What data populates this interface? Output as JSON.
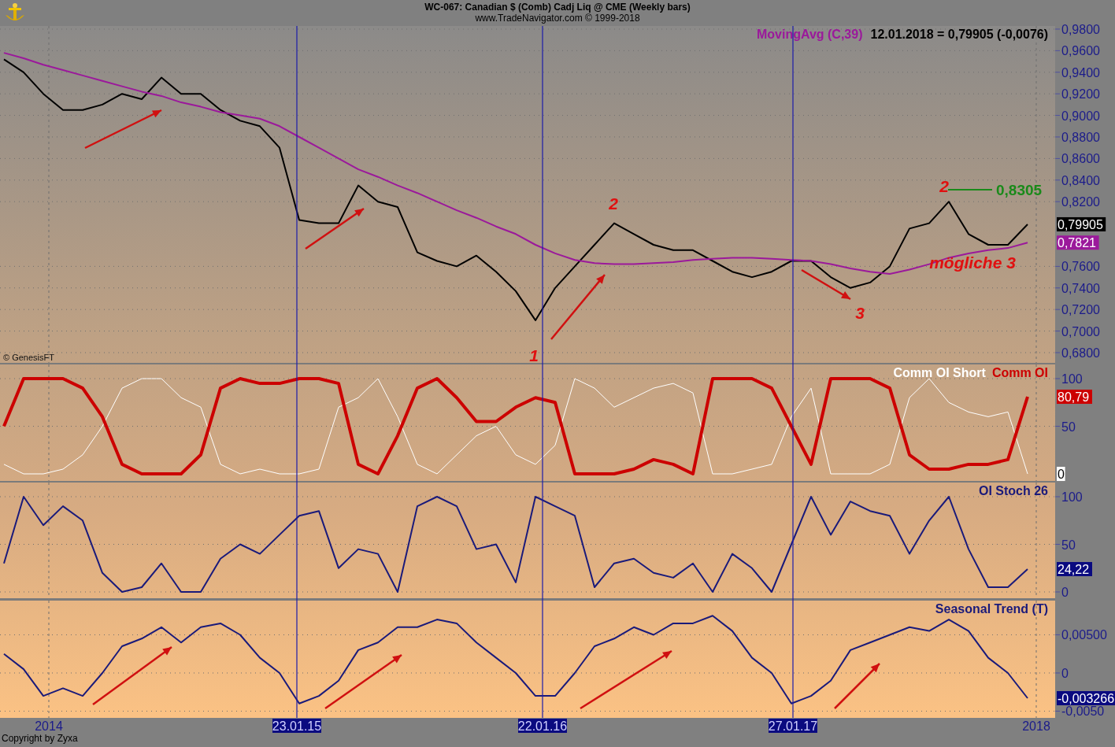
{
  "header": {
    "title": "WC-067:  Canadian $ (Comb) Cadj Liq @ CME  (Weekly bars)",
    "subtitle": "www.TradeNavigator.com © 1999-2018"
  },
  "source_note": "© GenesisFT",
  "time_axis": [
    {
      "label": "2014",
      "marked": false
    },
    {
      "label": "23.01.15",
      "marked": true
    },
    {
      "label": "22.01.16",
      "marked": true
    },
    {
      "label": "27.01.17",
      "marked": true
    },
    {
      "label": "2018",
      "marked": false
    }
  ],
  "panes": [
    {
      "kind": "price",
      "legend_value": "12.01.2018 = 0,79905 (-0,0076)",
      "labels": [
        {
          "kind": "wave",
          "text": "1"
        },
        {
          "kind": "wave",
          "text": "2"
        },
        {
          "kind": "wave",
          "text": "3"
        },
        {
          "kind": "wave",
          "text": "2"
        },
        {
          "kind": "wave",
          "text": "mögliche 3"
        },
        {
          "kind": "level",
          "text": "0,8305"
        }
      ],
      "value_flags": [
        {
          "text": "0,79905",
          "color": "#000000"
        },
        {
          "text": "0,7821",
          "color": "#9b199b"
        }
      ],
      "chart_data": {
        "type": "line",
        "grid": true,
        "ylim": [
          0.6705,
          0.9829
        ],
        "yticks": [
          {
            "value": 0.98,
            "label": "0,9800"
          },
          {
            "value": 0.96,
            "label": "0,9600"
          },
          {
            "value": 0.94,
            "label": "0,9400"
          },
          {
            "value": 0.92,
            "label": "0,9200"
          },
          {
            "value": 0.9,
            "label": "0,9000"
          },
          {
            "value": 0.88,
            "label": "0,8800"
          },
          {
            "value": 0.86,
            "label": "0,8600"
          },
          {
            "value": 0.84,
            "label": "0,8400"
          },
          {
            "value": 0.82,
            "label": "0,8200"
          },
          {
            "value": 0.76,
            "label": "0,7600"
          },
          {
            "value": 0.74,
            "label": "0,7400"
          },
          {
            "value": 0.72,
            "label": "0,7200"
          },
          {
            "value": 0.7,
            "label": "0,7000"
          },
          {
            "value": 0.68,
            "label": "0,6800"
          }
        ],
        "series": [
          {
            "color": "#000000",
            "values": [
              0.952,
              0.94,
              0.92,
              0.905,
              0.905,
              0.91,
              0.92,
              0.915,
              0.935,
              0.92,
              0.92,
              0.905,
              0.895,
              0.89,
              0.87,
              0.803,
              0.8,
              0.8,
              0.835,
              0.82,
              0.815,
              0.773,
              0.765,
              0.76,
              0.77,
              0.755,
              0.737,
              0.71,
              0.74,
              0.76,
              0.78,
              0.8,
              0.79,
              0.78,
              0.775,
              0.775,
              0.765,
              0.755,
              0.75,
              0.755,
              0.765,
              0.765,
              0.75,
              0.74,
              0.745,
              0.76,
              0.795,
              0.8,
              0.82,
              0.79,
              0.78,
              0.78,
              0.799
            ]
          },
          {
            "name": "MovingAvg (C,39)",
            "color": "#9b199b",
            "values": [
              0.958,
              0.953,
              0.947,
              0.942,
              0.937,
              0.932,
              0.927,
              0.922,
              0.918,
              0.912,
              0.908,
              0.903,
              0.9,
              0.897,
              0.89,
              0.88,
              0.87,
              0.86,
              0.85,
              0.843,
              0.835,
              0.828,
              0.82,
              0.812,
              0.805,
              0.797,
              0.79,
              0.78,
              0.772,
              0.766,
              0.763,
              0.762,
              0.762,
              0.763,
              0.764,
              0.766,
              0.767,
              0.768,
              0.768,
              0.767,
              0.766,
              0.765,
              0.762,
              0.758,
              0.755,
              0.753,
              0.757,
              0.762,
              0.768,
              0.772,
              0.775,
              0.777,
              0.782
            ]
          }
        ]
      }
    },
    {
      "kind": "comm",
      "value_flags": [
        {
          "text": "80,79",
          "color": "#cc0000"
        },
        {
          "text": "0",
          "color": "#ffffff"
        }
      ],
      "chart_data": {
        "type": "line",
        "grid": true,
        "ylim": [
          -7.4,
          114.9
        ],
        "yticks": [
          {
            "value": 50,
            "label": "50"
          },
          {
            "value": 100,
            "label": "100"
          }
        ],
        "series": [
          {
            "name": "Comm OI Short",
            "color": "#ffffff",
            "values": [
              10,
              0,
              0,
              5,
              20,
              50,
              90,
              100,
              100,
              80,
              70,
              10,
              0,
              5,
              0,
              0,
              5,
              70,
              80,
              100,
              60,
              10,
              0,
              20,
              40,
              50,
              20,
              10,
              30,
              100,
              90,
              70,
              80,
              90,
              95,
              85,
              0,
              0,
              5,
              10,
              60,
              90,
              0,
              0,
              0,
              10,
              80,
              100,
              75,
              65,
              60,
              65,
              0
            ]
          },
          {
            "name": "Comm OI",
            "color": "#cc0000",
            "values": [
              50,
              100,
              100,
              100,
              90,
              60,
              10,
              0,
              0,
              0,
              20,
              90,
              100,
              95,
              95,
              100,
              100,
              95,
              10,
              0,
              40,
              90,
              100,
              80,
              55,
              55,
              70,
              80,
              75,
              0,
              0,
              0,
              5,
              15,
              10,
              0,
              100,
              100,
              100,
              90,
              50,
              10,
              100,
              100,
              100,
              90,
              20,
              5,
              5,
              10,
              10,
              15,
              81
            ]
          }
        ]
      }
    },
    {
      "kind": "stoch",
      "value_flags": [
        {
          "text": "24,22",
          "color": "#0a0a80"
        }
      ],
      "chart_data": {
        "type": "line",
        "grid": true,
        "ylim": [
          -6.6,
          114.9
        ],
        "yticks": [
          {
            "value": 0,
            "label": "0"
          },
          {
            "value": 50,
            "label": "50"
          },
          {
            "value": 100,
            "label": "100"
          }
        ],
        "series": [
          {
            "name": "OI Stoch 26",
            "color": "#1a1a7a",
            "values": [
              30,
              100,
              70,
              90,
              75,
              20,
              0,
              5,
              30,
              0,
              0,
              35,
              50,
              40,
              60,
              80,
              85,
              25,
              45,
              40,
              0,
              90,
              100,
              90,
              45,
              50,
              10,
              100,
              90,
              80,
              5,
              30,
              35,
              20,
              15,
              30,
              0,
              40,
              25,
              0,
              50,
              100,
              60,
              95,
              85,
              80,
              40,
              75,
              100,
              45,
              5,
              5,
              24
            ]
          }
        ]
      }
    },
    {
      "kind": "seasonal",
      "value_flags": [
        {
          "text": "-0,003266",
          "color": "#0a0a80"
        }
      ],
      "chart_data": {
        "type": "line",
        "grid": true,
        "ylim": [
          -0.00588,
          0.00948
        ],
        "yticks": [
          {
            "value": -0.005,
            "label": "-0,0050"
          },
          {
            "value": 0,
            "label": "0"
          },
          {
            "value": 0.005,
            "label": "0,00500"
          }
        ],
        "series": [
          {
            "name": "Seasonal Trend (T)",
            "color": "#1a1a7a",
            "values": [
              0.0025,
              0.0005,
              -0.003,
              -0.002,
              -0.003,
              0,
              0.0035,
              0.0045,
              0.006,
              0.004,
              0.006,
              0.0065,
              0.005,
              0.002,
              0,
              -0.004,
              -0.003,
              -0.001,
              0.003,
              0.004,
              0.006,
              0.006,
              0.007,
              0.0065,
              0.004,
              0.002,
              0,
              -0.003,
              -0.003,
              0,
              0.0035,
              0.0045,
              0.006,
              0.005,
              0.0065,
              0.0065,
              0.0075,
              0.0055,
              0.002,
              0,
              -0.004,
              -0.003,
              -0.001,
              0.003,
              0.004,
              0.005,
              0.006,
              0.0055,
              0.007,
              0.0055,
              0.002,
              0,
              -0.0033
            ]
          }
        ]
      }
    }
  ],
  "footer": "Copyright by Zyxa"
}
